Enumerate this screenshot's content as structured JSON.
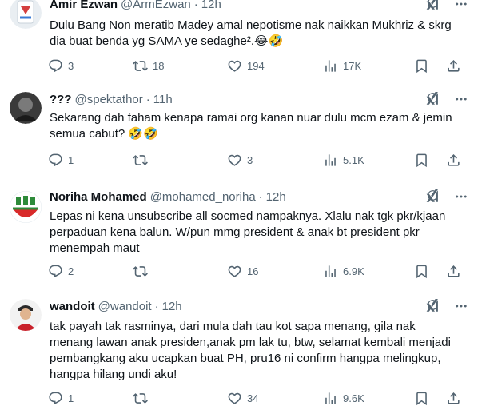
{
  "tweets": [
    {
      "name": "Amir Ezwan",
      "handle": "@ArmEzwan",
      "sep": "·",
      "time": "12h",
      "text": "Dulu Bang Non meratib Madey amal nepotisme nak naikkan Mukhriz & skrg\ndia buat benda yg SAMA ye sedaghe².😂🤣",
      "replies": "3",
      "retweets": "18",
      "likes": "194",
      "views": "17K",
      "avatar_colors": [
        "#ffffff",
        "#d43f3f",
        "#3a7bd5"
      ]
    },
    {
      "name": "???",
      "handle": "@spektathor",
      "sep": "·",
      "time": "11h",
      "text": "Sekarang dah faham kenapa ramai org kanan nuar dulu mcm ezam & jemin\nsemua cabut? 🤣🤣",
      "replies": "1",
      "retweets": "",
      "likes": "3",
      "views": "5.1K",
      "avatar_colors": [
        "#2b2b2b",
        "#6a6a6a",
        "#1a1a1a"
      ]
    },
    {
      "name": "Noriha Mohamed",
      "handle": "@mohamed_noriha",
      "sep": "·",
      "time": "12h",
      "text": "Lepas ni kena unsubscribe all socmed nampaknya. Xlalu nak tgk pkr/kjaan\nperpaduan kena balun. W/pun mmg president & anak bt president pkr\nmenempah maut",
      "replies": "2",
      "retweets": "",
      "likes": "16",
      "views": "6.9K",
      "avatar_colors": [
        "#2e8b3a",
        "#d82a2a",
        "#ffffff"
      ]
    },
    {
      "name": "wandoit",
      "handle": "@wandoit",
      "sep": "·",
      "time": "12h",
      "text": "tak payah tak rasminya, dari mula dah tau kot sapa menang, gila nak\nmenang lawan anak presiden,anak pm lak tu, btw, selamat kembali menjadi\npembangkang aku ucapkan buat PH, pru16 ni confirm hangpa melingkup,\nhangpa hilang undi aku!",
      "replies": "1",
      "retweets": "",
      "likes": "34",
      "views": "9.6K",
      "avatar_colors": [
        "#f2f2f2",
        "#c8202a",
        "#2a2a2a"
      ]
    }
  ],
  "icons": {
    "grok": "grok-icon",
    "more": "more-icon",
    "reply": "reply-icon",
    "retweet": "retweet-icon",
    "like": "like-icon",
    "views": "views-icon",
    "bookmark": "bookmark-icon",
    "share": "share-icon"
  }
}
